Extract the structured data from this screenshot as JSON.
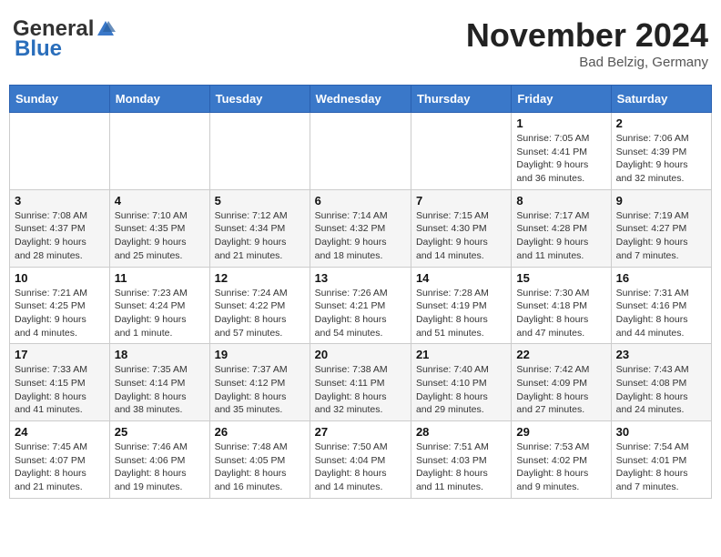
{
  "header": {
    "logo_general": "General",
    "logo_blue": "Blue",
    "month_title": "November 2024",
    "location": "Bad Belzig, Germany"
  },
  "days_of_week": [
    "Sunday",
    "Monday",
    "Tuesday",
    "Wednesday",
    "Thursday",
    "Friday",
    "Saturday"
  ],
  "weeks": [
    [
      {
        "day": "",
        "info": ""
      },
      {
        "day": "",
        "info": ""
      },
      {
        "day": "",
        "info": ""
      },
      {
        "day": "",
        "info": ""
      },
      {
        "day": "",
        "info": ""
      },
      {
        "day": "1",
        "info": "Sunrise: 7:05 AM\nSunset: 4:41 PM\nDaylight: 9 hours\nand 36 minutes."
      },
      {
        "day": "2",
        "info": "Sunrise: 7:06 AM\nSunset: 4:39 PM\nDaylight: 9 hours\nand 32 minutes."
      }
    ],
    [
      {
        "day": "3",
        "info": "Sunrise: 7:08 AM\nSunset: 4:37 PM\nDaylight: 9 hours\nand 28 minutes."
      },
      {
        "day": "4",
        "info": "Sunrise: 7:10 AM\nSunset: 4:35 PM\nDaylight: 9 hours\nand 25 minutes."
      },
      {
        "day": "5",
        "info": "Sunrise: 7:12 AM\nSunset: 4:34 PM\nDaylight: 9 hours\nand 21 minutes."
      },
      {
        "day": "6",
        "info": "Sunrise: 7:14 AM\nSunset: 4:32 PM\nDaylight: 9 hours\nand 18 minutes."
      },
      {
        "day": "7",
        "info": "Sunrise: 7:15 AM\nSunset: 4:30 PM\nDaylight: 9 hours\nand 14 minutes."
      },
      {
        "day": "8",
        "info": "Sunrise: 7:17 AM\nSunset: 4:28 PM\nDaylight: 9 hours\nand 11 minutes."
      },
      {
        "day": "9",
        "info": "Sunrise: 7:19 AM\nSunset: 4:27 PM\nDaylight: 9 hours\nand 7 minutes."
      }
    ],
    [
      {
        "day": "10",
        "info": "Sunrise: 7:21 AM\nSunset: 4:25 PM\nDaylight: 9 hours\nand 4 minutes."
      },
      {
        "day": "11",
        "info": "Sunrise: 7:23 AM\nSunset: 4:24 PM\nDaylight: 9 hours\nand 1 minute."
      },
      {
        "day": "12",
        "info": "Sunrise: 7:24 AM\nSunset: 4:22 PM\nDaylight: 8 hours\nand 57 minutes."
      },
      {
        "day": "13",
        "info": "Sunrise: 7:26 AM\nSunset: 4:21 PM\nDaylight: 8 hours\nand 54 minutes."
      },
      {
        "day": "14",
        "info": "Sunrise: 7:28 AM\nSunset: 4:19 PM\nDaylight: 8 hours\nand 51 minutes."
      },
      {
        "day": "15",
        "info": "Sunrise: 7:30 AM\nSunset: 4:18 PM\nDaylight: 8 hours\nand 47 minutes."
      },
      {
        "day": "16",
        "info": "Sunrise: 7:31 AM\nSunset: 4:16 PM\nDaylight: 8 hours\nand 44 minutes."
      }
    ],
    [
      {
        "day": "17",
        "info": "Sunrise: 7:33 AM\nSunset: 4:15 PM\nDaylight: 8 hours\nand 41 minutes."
      },
      {
        "day": "18",
        "info": "Sunrise: 7:35 AM\nSunset: 4:14 PM\nDaylight: 8 hours\nand 38 minutes."
      },
      {
        "day": "19",
        "info": "Sunrise: 7:37 AM\nSunset: 4:12 PM\nDaylight: 8 hours\nand 35 minutes."
      },
      {
        "day": "20",
        "info": "Sunrise: 7:38 AM\nSunset: 4:11 PM\nDaylight: 8 hours\nand 32 minutes."
      },
      {
        "day": "21",
        "info": "Sunrise: 7:40 AM\nSunset: 4:10 PM\nDaylight: 8 hours\nand 29 minutes."
      },
      {
        "day": "22",
        "info": "Sunrise: 7:42 AM\nSunset: 4:09 PM\nDaylight: 8 hours\nand 27 minutes."
      },
      {
        "day": "23",
        "info": "Sunrise: 7:43 AM\nSunset: 4:08 PM\nDaylight: 8 hours\nand 24 minutes."
      }
    ],
    [
      {
        "day": "24",
        "info": "Sunrise: 7:45 AM\nSunset: 4:07 PM\nDaylight: 8 hours\nand 21 minutes."
      },
      {
        "day": "25",
        "info": "Sunrise: 7:46 AM\nSunset: 4:06 PM\nDaylight: 8 hours\nand 19 minutes."
      },
      {
        "day": "26",
        "info": "Sunrise: 7:48 AM\nSunset: 4:05 PM\nDaylight: 8 hours\nand 16 minutes."
      },
      {
        "day": "27",
        "info": "Sunrise: 7:50 AM\nSunset: 4:04 PM\nDaylight: 8 hours\nand 14 minutes."
      },
      {
        "day": "28",
        "info": "Sunrise: 7:51 AM\nSunset: 4:03 PM\nDaylight: 8 hours\nand 11 minutes."
      },
      {
        "day": "29",
        "info": "Sunrise: 7:53 AM\nSunset: 4:02 PM\nDaylight: 8 hours\nand 9 minutes."
      },
      {
        "day": "30",
        "info": "Sunrise: 7:54 AM\nSunset: 4:01 PM\nDaylight: 8 hours\nand 7 minutes."
      }
    ]
  ]
}
